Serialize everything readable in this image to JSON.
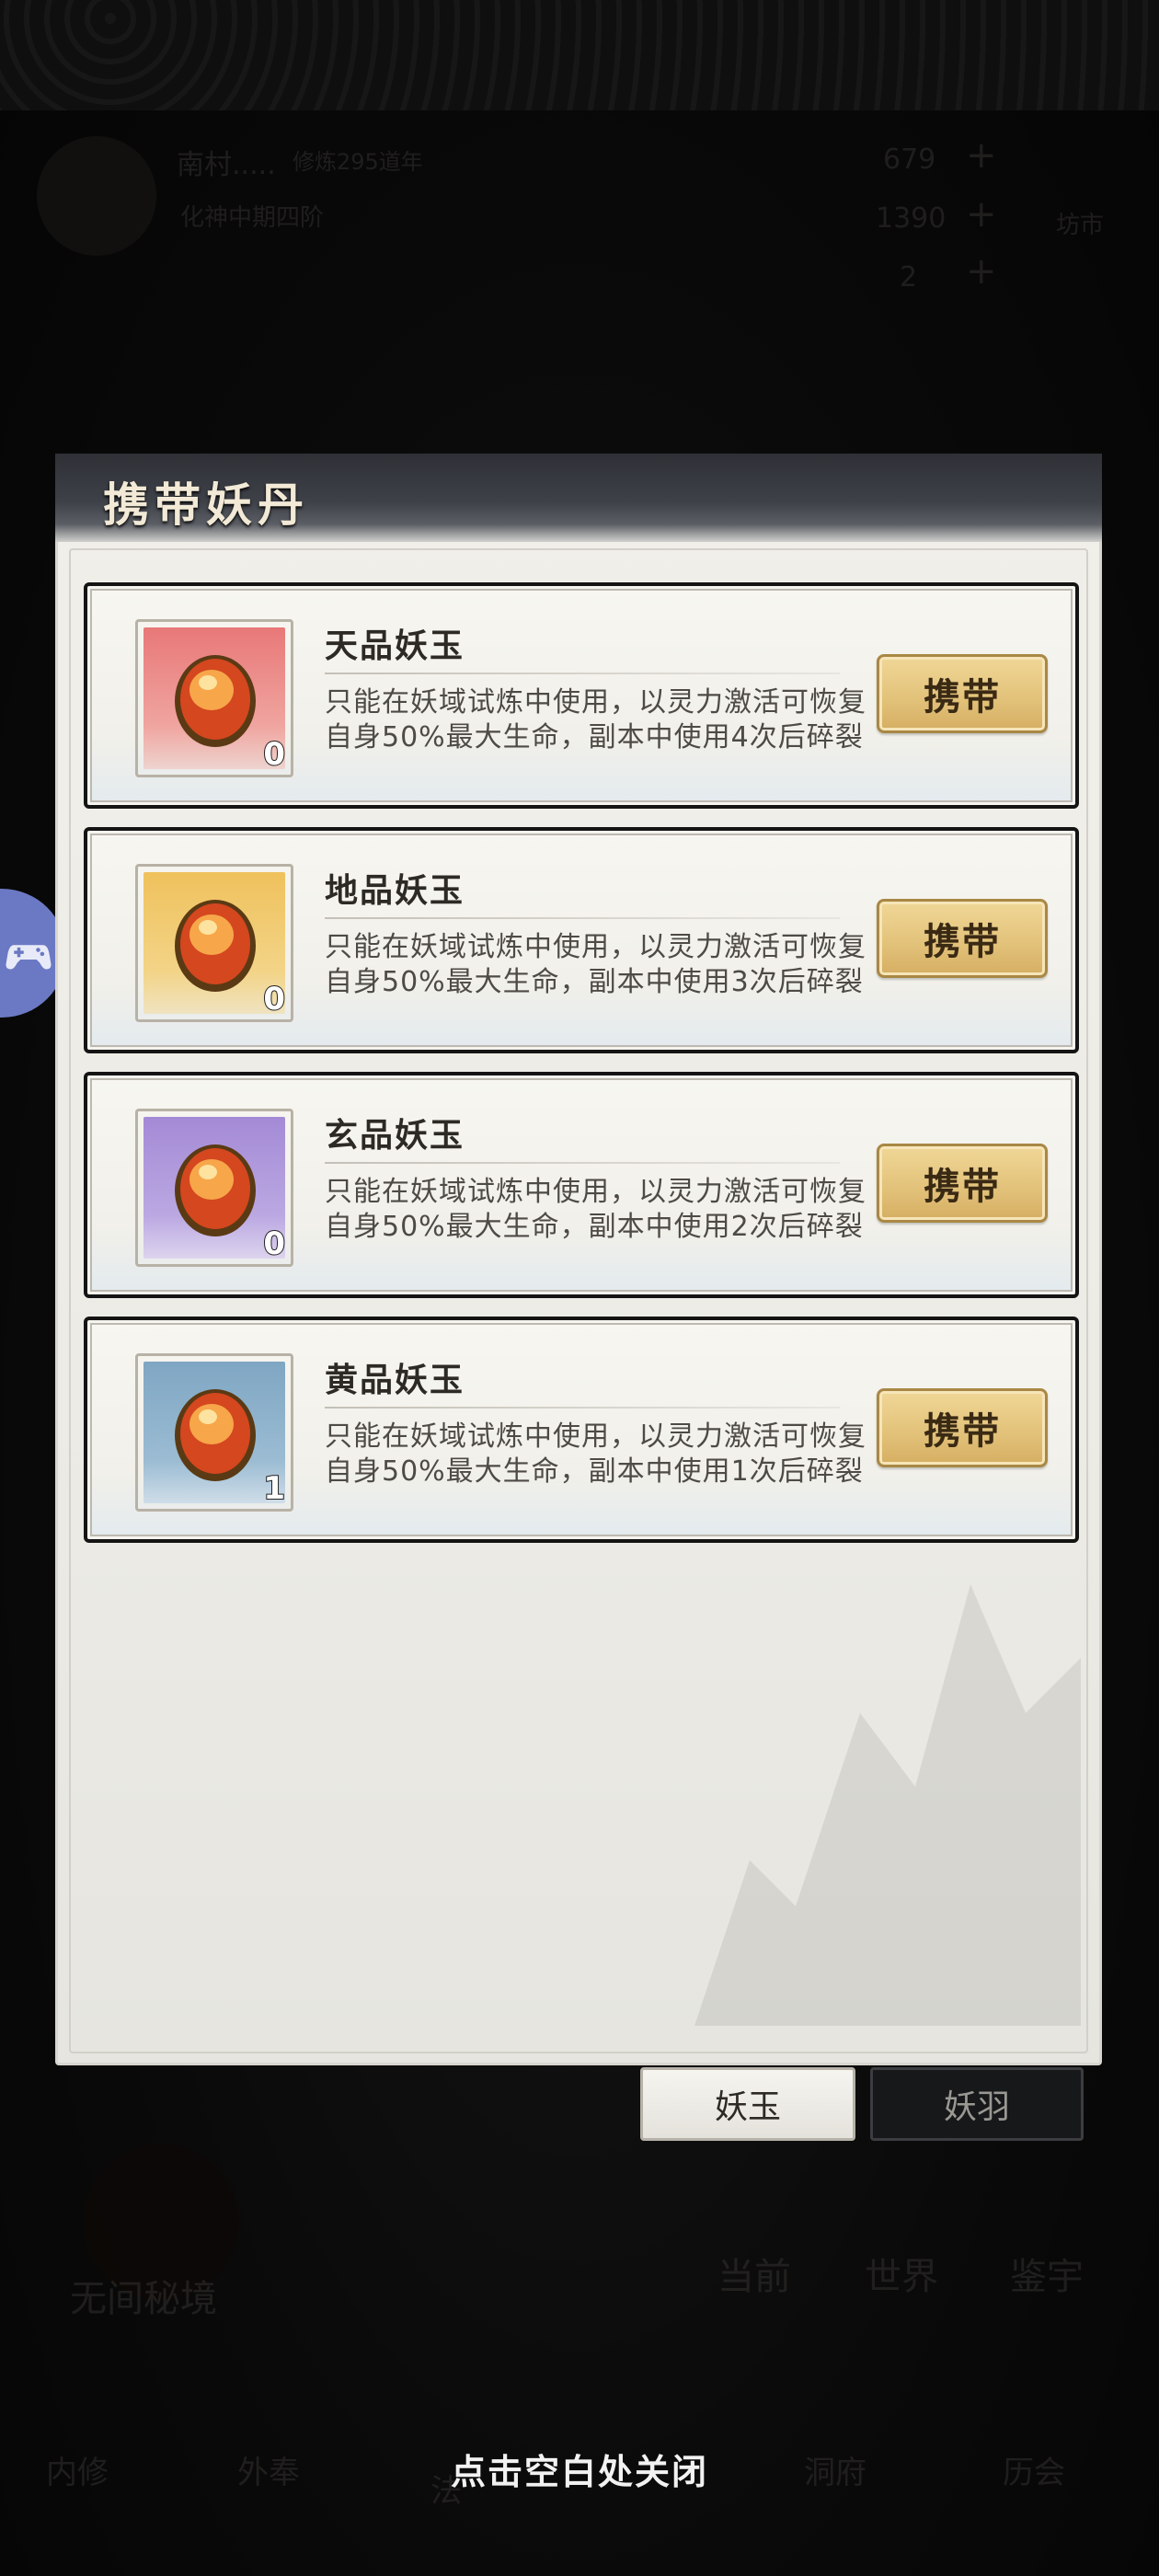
{
  "background": {
    "player_name": "南村.....",
    "cultivation": "修炼295道年",
    "realm": "化神中期四阶",
    "resources": [
      "679",
      "1390",
      "2"
    ],
    "market_label": "坊市",
    "secret_realm": "无间秘境",
    "chat_tabs": [
      "当前",
      "世界",
      "鉴宇"
    ],
    "bottom_nav_1": "内修",
    "bottom_nav_2": "外奉",
    "bottom_nav_3": "法",
    "bottom_nav_4": "洞府",
    "bottom_nav_5": "历会"
  },
  "panel": {
    "title": "携带妖丹"
  },
  "items": [
    {
      "name": "天品妖玉",
      "desc": "只能在妖域试炼中使用，以灵力激活可恢复自身50%最大生命，副本中使用4次后碎裂",
      "count": "0",
      "button": "携带",
      "color": "#e87878"
    },
    {
      "name": "地品妖玉",
      "desc": "只能在妖域试炼中使用，以灵力激活可恢复自身50%最大生命，副本中使用3次后碎裂",
      "count": "0",
      "button": "携带",
      "color": "#efc15c"
    },
    {
      "name": "玄品妖玉",
      "desc": "只能在妖域试炼中使用，以灵力激活可恢复自身50%最大生命，副本中使用2次后碎裂",
      "count": "0",
      "button": "携带",
      "color": "#a48ad6"
    },
    {
      "name": "黄品妖玉",
      "desc": "只能在妖域试炼中使用，以灵力激活可恢复自身50%最大生命，副本中使用1次后碎裂",
      "count": "1",
      "button": "携带",
      "color": "#7fa6c3"
    }
  ],
  "tabs": {
    "active": "妖玉",
    "inactive": "妖羽"
  },
  "close_hint": "点击空白处关闭"
}
